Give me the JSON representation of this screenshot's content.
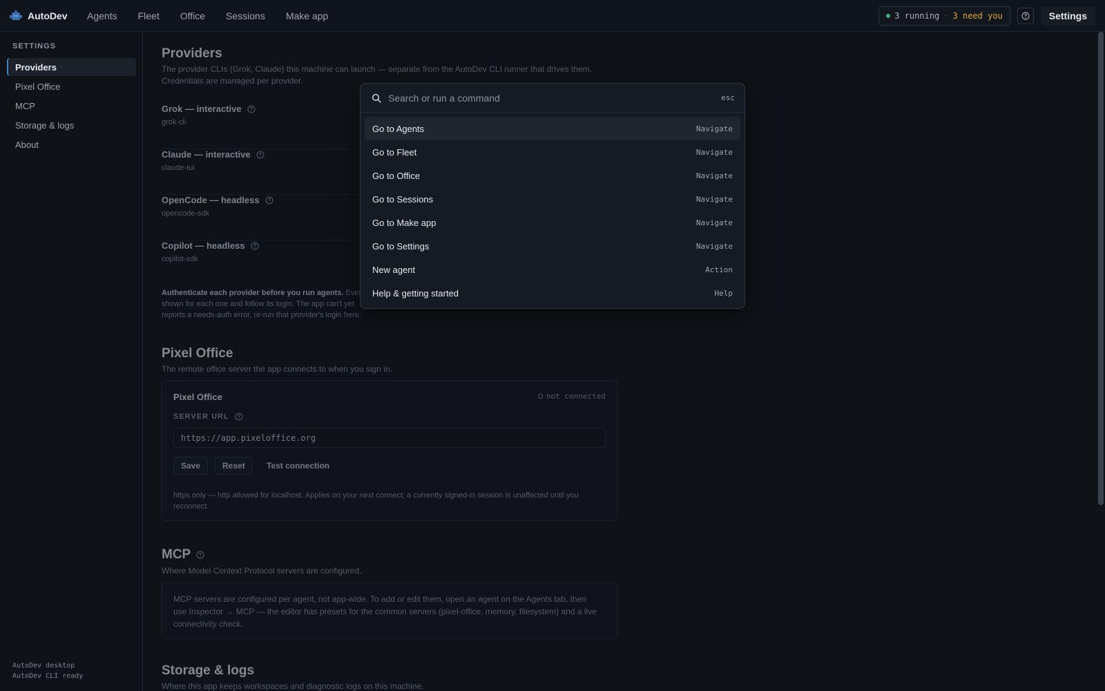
{
  "app": {
    "name": "AutoDev"
  },
  "nav": [
    "Agents",
    "Fleet",
    "Office",
    "Sessions",
    "Make app"
  ],
  "status": {
    "running": "3 running",
    "separator": "·",
    "need": "3 need you"
  },
  "settings_button": "Settings",
  "sidebar": {
    "heading": "SETTINGS",
    "items": [
      "Providers",
      "Pixel Office",
      "MCP",
      "Storage & logs",
      "About"
    ],
    "footer_line1": "AutoDev desktop",
    "footer_line2": "AutoDev CLI ready"
  },
  "providers": {
    "title": "Providers",
    "subtitle_line1": "The provider CLIs (Grok, Claude) this machine can launch — separate from the AutoDev CLI runner that drives them.",
    "subtitle_line2": "Credentials are managed per provider.",
    "list": [
      {
        "name": "Grok — interactive",
        "id": "grok-cli"
      },
      {
        "name": "Claude — interactive",
        "id": "claude-tui"
      },
      {
        "name": "OpenCode — headless",
        "id": "opencode-sdk"
      },
      {
        "name": "Copilot — headless",
        "id": "copilot-sdk"
      }
    ],
    "note_bold": "Authenticate each provider before you run agents.",
    "note_rest1": " Ever",
    "note_line2": "shown for each one and follow its login. The app can't yet",
    "note_line3": "reports a needs-auth error, re-run that provider's login here."
  },
  "pixel_office": {
    "title": "Pixel Office",
    "subtitle": "The remote office server the app connects to when you sign in.",
    "card_title": "Pixel Office",
    "connection": "not connected",
    "field_label": "SERVER URL",
    "url_value": "https://app.pixeloffice.org",
    "save": "Save",
    "reset": "Reset",
    "test": "Test connection",
    "note": "https only — http allowed for localhost. Applies on your next connect; a currently signed-in session is unaffected until you reconnect."
  },
  "mcp": {
    "title": "MCP",
    "subtitle": "Where Model Context Protocol servers are configured.",
    "note": "MCP servers are configured per agent, not app-wide. To add or edit them, open an agent on the Agents tab, then use Inspector → MCP — the editor has presets for the common servers (pixel-office, memory, filesystem) and a live connectivity check."
  },
  "storage": {
    "title": "Storage & logs",
    "subtitle": "Where this app keeps workspaces and diagnostic logs on this machine."
  },
  "palette": {
    "placeholder": "Search or run a command",
    "esc": "esc",
    "items": [
      {
        "label": "Go to Agents",
        "kind": "Navigate"
      },
      {
        "label": "Go to Fleet",
        "kind": "Navigate"
      },
      {
        "label": "Go to Office",
        "kind": "Navigate"
      },
      {
        "label": "Go to Sessions",
        "kind": "Navigate"
      },
      {
        "label": "Go to Make app",
        "kind": "Navigate"
      },
      {
        "label": "Go to Settings",
        "kind": "Navigate"
      },
      {
        "label": "New agent",
        "kind": "Action"
      },
      {
        "label": "Help & getting started",
        "kind": "Help"
      }
    ]
  },
  "colors": {
    "accent": "#3b82c4",
    "running": "#3fb27f",
    "warning": "#d9a441",
    "background": "#0f1318"
  }
}
